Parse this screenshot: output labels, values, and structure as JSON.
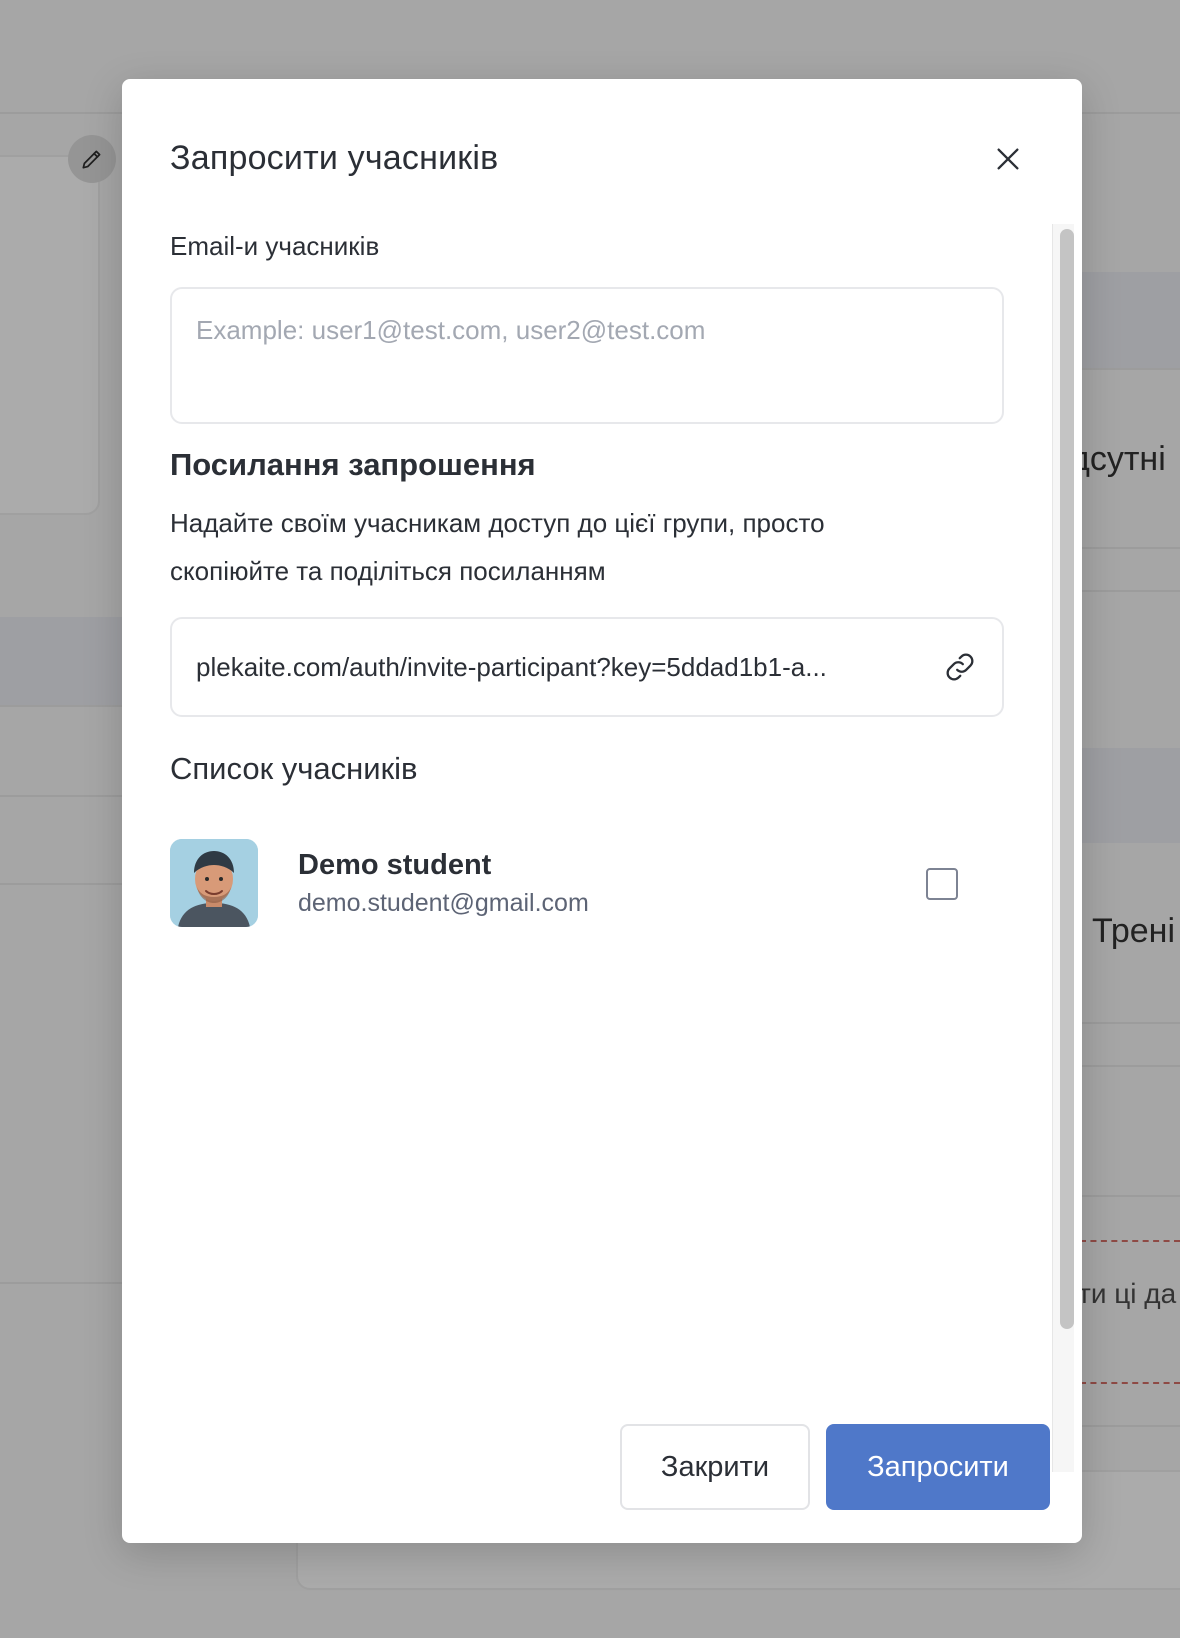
{
  "background": {
    "fragments": {
      "text_1": "дсутні",
      "text_2": "Трені",
      "text_3": "ти ці да"
    }
  },
  "modal": {
    "title": "Запросити учасників",
    "emails": {
      "label": "Email-и учасників",
      "value": "",
      "placeholder": "Example: user1@test.com, user2@test.com"
    },
    "invite_link": {
      "title": "Посилання запрошення",
      "description_line1": "Надайте своїм учасникам доступ до цієї групи, просто",
      "description_line2": "скопіюйте та поділіться посиланням",
      "url": "plekaite.com/auth/invite-participant?key=5ddad1b1-a..."
    },
    "participants": {
      "title": "Список учасників",
      "items": [
        {
          "name": "Demo student",
          "email": "demo.student@gmail.com",
          "checked": false
        }
      ]
    },
    "buttons": {
      "close_label": "Закрити",
      "invite_label": "Запросити"
    }
  },
  "colors": {
    "primary": "#4f78c9",
    "overlay": "#a6a6a6",
    "text": "#2b2f36",
    "muted": "#5d6475"
  },
  "icons": {
    "close": "close-icon",
    "copy_link": "link-icon",
    "edit": "pencil-icon"
  }
}
